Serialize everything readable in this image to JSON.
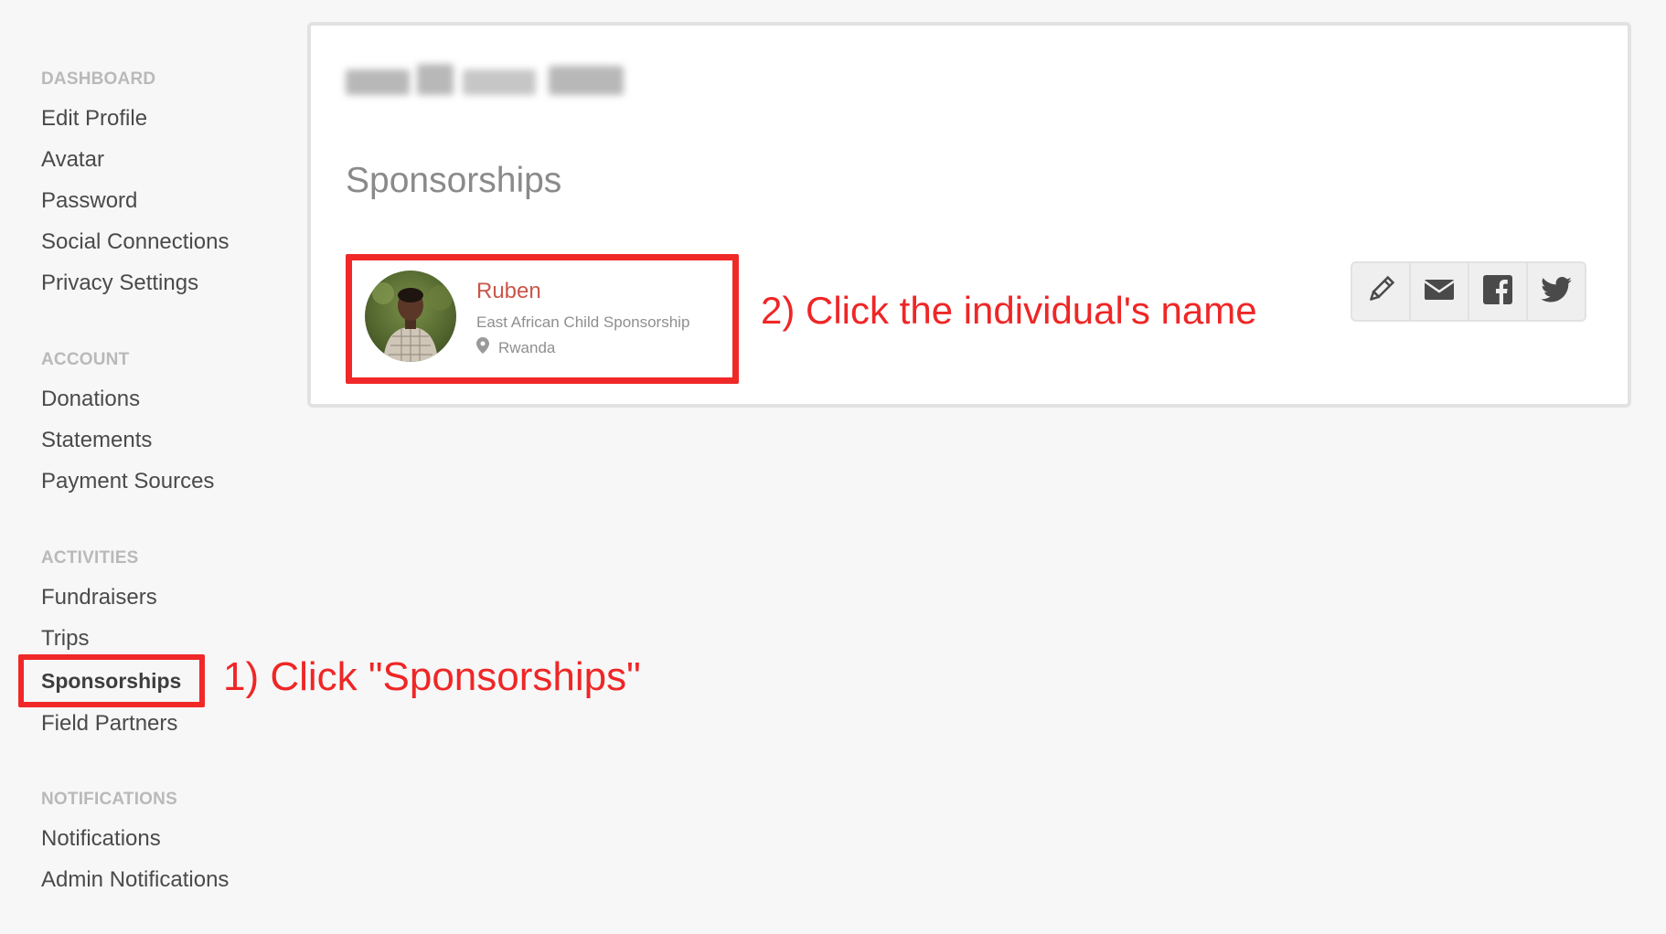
{
  "sidebar": {
    "sections": [
      {
        "heading": "DASHBOARD",
        "items": [
          "Edit Profile",
          "Avatar",
          "Password",
          "Social Connections",
          "Privacy Settings"
        ]
      },
      {
        "heading": "ACCOUNT",
        "items": [
          "Donations",
          "Statements",
          "Payment Sources"
        ]
      },
      {
        "heading": "ACTIVITIES",
        "items": [
          "Fundraisers",
          "Trips",
          "Sponsorships",
          "Field Partners"
        ]
      },
      {
        "heading": "NOTIFICATIONS",
        "items": [
          "Notifications",
          "Admin Notifications"
        ]
      }
    ],
    "active_item": "Sponsorships"
  },
  "main": {
    "title": "Sponsorships",
    "sponsorship": {
      "name": "Ruben",
      "program": "East African Child Sponsorship",
      "location": "Rwanda"
    },
    "actions": [
      {
        "icon": "pencil-icon",
        "name": "edit-button"
      },
      {
        "icon": "envelope-icon",
        "name": "email-button"
      },
      {
        "icon": "facebook-icon",
        "name": "facebook-share-button"
      },
      {
        "icon": "twitter-icon",
        "name": "twitter-share-button"
      }
    ]
  },
  "annotations": {
    "step1": "1) Click \"Sponsorships\"",
    "step2": "2) Click the individual's name"
  },
  "colors": {
    "annotation_red": "#f02828",
    "link_red": "#c9564a",
    "heading_gray": "#b9b9b9",
    "background": "#f7f7f7"
  }
}
